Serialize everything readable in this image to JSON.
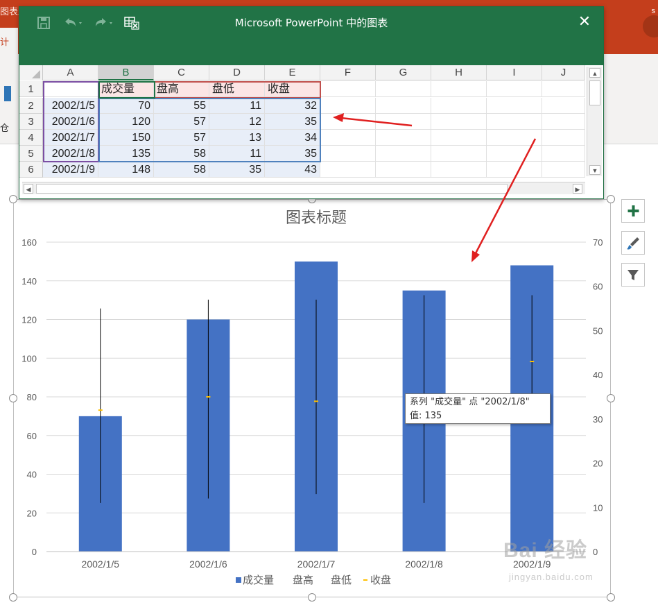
{
  "powerpoint": {
    "context_tab": "图表工具",
    "left_tab": "计",
    "left_tab2": "仓",
    "account": "s"
  },
  "excel": {
    "title": "Microsoft PowerPoint 中的图表",
    "save_icon": "save-icon",
    "undo_icon": "undo-icon",
    "redo_icon": "redo-icon",
    "edit_data_icon": "edit-data-in-excel-icon",
    "close_glyph": "✕",
    "columns": [
      "A",
      "B",
      "C",
      "D",
      "E",
      "F",
      "G",
      "H",
      "I",
      "J"
    ],
    "rows": [
      "1",
      "2",
      "3",
      "4",
      "5",
      "6"
    ],
    "header_row": [
      "",
      "成交量",
      "盘高",
      "盘低",
      "收盘"
    ],
    "data_rows": [
      [
        "2002/1/5",
        "70",
        "55",
        "11",
        "32"
      ],
      [
        "2002/1/6",
        "120",
        "57",
        "12",
        "35"
      ],
      [
        "2002/1/7",
        "150",
        "57",
        "13",
        "34"
      ],
      [
        "2002/1/8",
        "135",
        "58",
        "11",
        "35"
      ],
      [
        "2002/1/9",
        "148",
        "58",
        "35",
        "43"
      ]
    ]
  },
  "chart_data": {
    "type": "bar",
    "title": "图表标题",
    "categories": [
      "2002/1/5",
      "2002/1/6",
      "2002/1/7",
      "2002/1/8",
      "2002/1/9"
    ],
    "series": [
      {
        "name": "成交量",
        "axis": "primary",
        "kind": "bar",
        "values": [
          70,
          120,
          150,
          135,
          148
        ]
      },
      {
        "name": "盘高",
        "axis": "secondary",
        "kind": "hilo-high",
        "values": [
          55,
          57,
          57,
          58,
          58
        ]
      },
      {
        "name": "盘低",
        "axis": "secondary",
        "kind": "hilo-low",
        "values": [
          11,
          12,
          13,
          11,
          35
        ]
      },
      {
        "name": "收盘",
        "axis": "secondary",
        "kind": "close-marker",
        "values": [
          32,
          35,
          34,
          35,
          43
        ]
      }
    ],
    "ylim": [
      0,
      160
    ],
    "y_ticks": [
      "0",
      "20",
      "40",
      "60",
      "80",
      "100",
      "120",
      "140",
      "160"
    ],
    "y2lim": [
      0,
      70
    ],
    "y2_ticks": [
      "0",
      "10",
      "20",
      "30",
      "40",
      "50",
      "60",
      "70"
    ],
    "grid": true,
    "legend_position": "bottom",
    "colors": {
      "bar": "#4472c4",
      "hilo": "#000000",
      "close": "#ffc000",
      "grid": "#d9d9d9",
      "axis_text": "#595959"
    }
  },
  "tooltip": {
    "line1": "系列 \"成交量\" 点 \"2002/1/8\"",
    "line2": "值: 135"
  },
  "side_buttons": {
    "add": "chart-elements-plus-icon",
    "style": "chart-styles-brush-icon",
    "filter": "chart-filters-funnel-icon"
  },
  "watermark": {
    "text1": "Bai 经验",
    "text2": "jingyan.baidu.com"
  }
}
